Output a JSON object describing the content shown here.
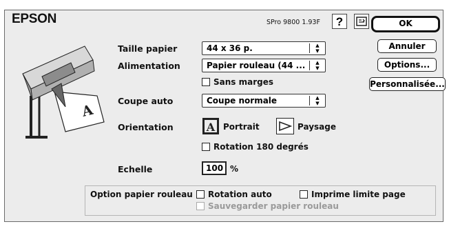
{
  "header": {
    "brand": "EPSON",
    "version": "SPro 9800 1.93F",
    "help_label": "?"
  },
  "buttons": {
    "ok": "OK",
    "cancel": "Annuler",
    "options": "Options...",
    "custom": "Personnalisée..."
  },
  "paper_size": {
    "label": "Taille papier",
    "value": "44 x 36 p."
  },
  "source": {
    "label": "Alimentation",
    "value": "Papier rouleau (44 ..."
  },
  "borderless": {
    "label": "Sans marges",
    "checked": false
  },
  "auto_cut": {
    "label": "Coupe auto",
    "value": "Coupe normale"
  },
  "orientation": {
    "label": "Orientation",
    "portrait": "Portrait",
    "landscape": "Paysage",
    "selected": "portrait"
  },
  "rotate180": {
    "label": "Rotation 180 degrés",
    "checked": false
  },
  "scale": {
    "label": "Echelle",
    "value": "100",
    "unit": "%"
  },
  "roll_options": {
    "label": "Option papier rouleau",
    "auto_rotate": {
      "label": "Rotation auto",
      "checked": false
    },
    "print_page_line": {
      "label": "Imprime limite page",
      "checked": false
    },
    "save_roll_paper": {
      "label": "Sauvegarder papier rouleau",
      "checked": false,
      "enabled": false
    }
  },
  "icons": {
    "printer_preview": "wide-format-printer-illustration",
    "help": "help-icon",
    "utility": "printer-utility-icon"
  },
  "colors": {
    "window_bg": "#ececec",
    "border": "#222222",
    "disabled_text": "#9a9a9a"
  }
}
